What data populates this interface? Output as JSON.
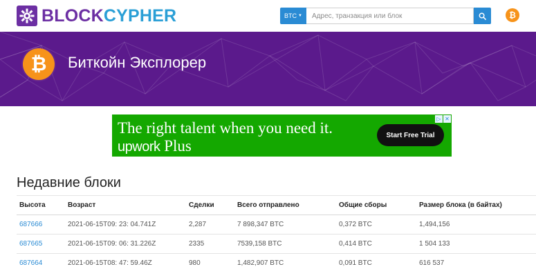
{
  "header": {
    "logo_part1": "BLOCK",
    "logo_part2": "CYPHER",
    "coin_selector": "BTC",
    "search_placeholder": "Адрес, транзакция или блок",
    "search_icon": "search-icon",
    "coin_icon": "bitcoin-icon",
    "colors": {
      "brand_purple": "#6c2fa3",
      "brand_blue": "#2a9fd6",
      "accent": "#2a8bd4",
      "bitcoin": "#f7931a"
    }
  },
  "banner": {
    "title": "Биткойн Эксплорер",
    "icon": "bitcoin-icon",
    "color": "#5b1a8c"
  },
  "ad": {
    "headline": "The right talent when you need it.",
    "brand_logo": "upwork",
    "brand_suffix": "Plus",
    "cta": "Start Free Trial",
    "color": "#14a800"
  },
  "recent_blocks": {
    "title": "Недавние блоки",
    "columns": [
      "Высота",
      "Возраст",
      "Сделки",
      "Всего отправлено",
      "Общие сборы",
      "Размер блока (в байтах)"
    ],
    "rows": [
      [
        "687666",
        "2021-06-15T09: 23: 04.741Z",
        "2,287",
        "7 898,347 BTC",
        "0,372 BTC",
        "1,494,156"
      ],
      [
        "687665",
        "2021-06-15T09: 06: 31.226Z",
        "2335",
        "7539,158 BTC",
        "0,414 BTC",
        "1 504 133"
      ],
      [
        "687664",
        "2021-06-15T08: 47: 59.46Z",
        "980",
        "1,482,907 BTC",
        "0,091 BTC",
        "616 537"
      ]
    ]
  }
}
